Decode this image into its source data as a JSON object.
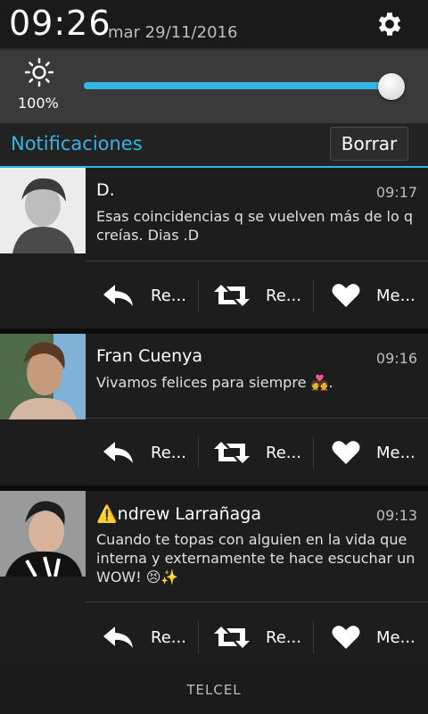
{
  "status": {
    "time": "09:26",
    "date": "mar 29/11/2016",
    "settings_icon": "gear-icon"
  },
  "brightness": {
    "percent_label": "100%",
    "level": 1.0,
    "icon": "sun-icon"
  },
  "notifications": {
    "title": "Notificaciones",
    "clear_label": "Borrar",
    "items": [
      {
        "name": "D.",
        "time": "09:17",
        "message": "Esas coincidencias q se vuelven más de lo q creías. Dias .D",
        "actions": [
          "Re...",
          "Re...",
          "Me..."
        ]
      },
      {
        "name": "Fran Cuenya",
        "time": "09:16",
        "message": "Vivamos felices para siempre 💑.",
        "actions": [
          "Re...",
          "Re...",
          "Me..."
        ]
      },
      {
        "name": "⚠️ndrew Larrañaga",
        "time": "09:13",
        "message": "Cuando te topas con alguien en la vida que interna y externamente te hace escuchar un WOW! 😣✨",
        "actions": [
          "Re...",
          "Re...",
          "Me..."
        ]
      }
    ]
  },
  "carrier": "TELCEL",
  "colors": {
    "accent": "#33b5e5",
    "background": "#101010"
  }
}
